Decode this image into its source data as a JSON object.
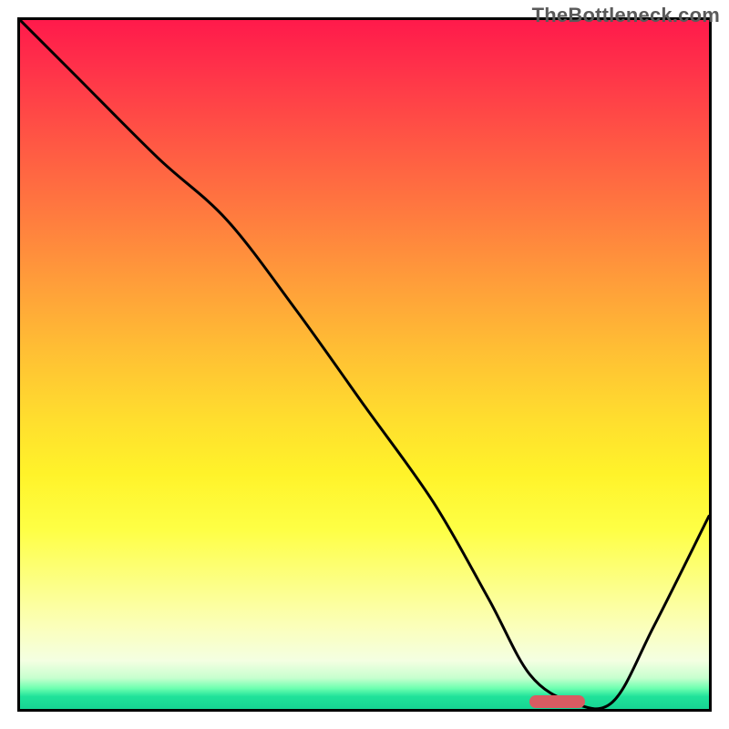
{
  "watermark": "TheBottleneck.com",
  "chart_data": {
    "type": "line",
    "title": "",
    "xlabel": "",
    "ylabel": "",
    "xlim": [
      0,
      100
    ],
    "ylim": [
      0,
      100
    ],
    "grid": false,
    "legend": false,
    "background": "gradient-bottleneck",
    "series": [
      {
        "name": "bottleneck-curve",
        "x": [
          0,
          8,
          20,
          30,
          40,
          50,
          60,
          68,
          74,
          80,
          86,
          92,
          100
        ],
        "y": [
          100,
          92,
          80,
          71,
          58,
          44,
          30,
          16,
          5,
          1,
          1,
          12,
          28
        ]
      }
    ],
    "marker": {
      "name": "optimal-range",
      "x_start": 74,
      "x_end": 82,
      "y": 1,
      "color": "#d95b62"
    },
    "gradient_stops": [
      {
        "pos": 0.0,
        "color": "#ff1a4b"
      },
      {
        "pos": 0.5,
        "color": "#ffde2e"
      },
      {
        "pos": 0.9,
        "color": "#fbffba"
      },
      {
        "pos": 1.0,
        "color": "#17d493"
      }
    ]
  }
}
